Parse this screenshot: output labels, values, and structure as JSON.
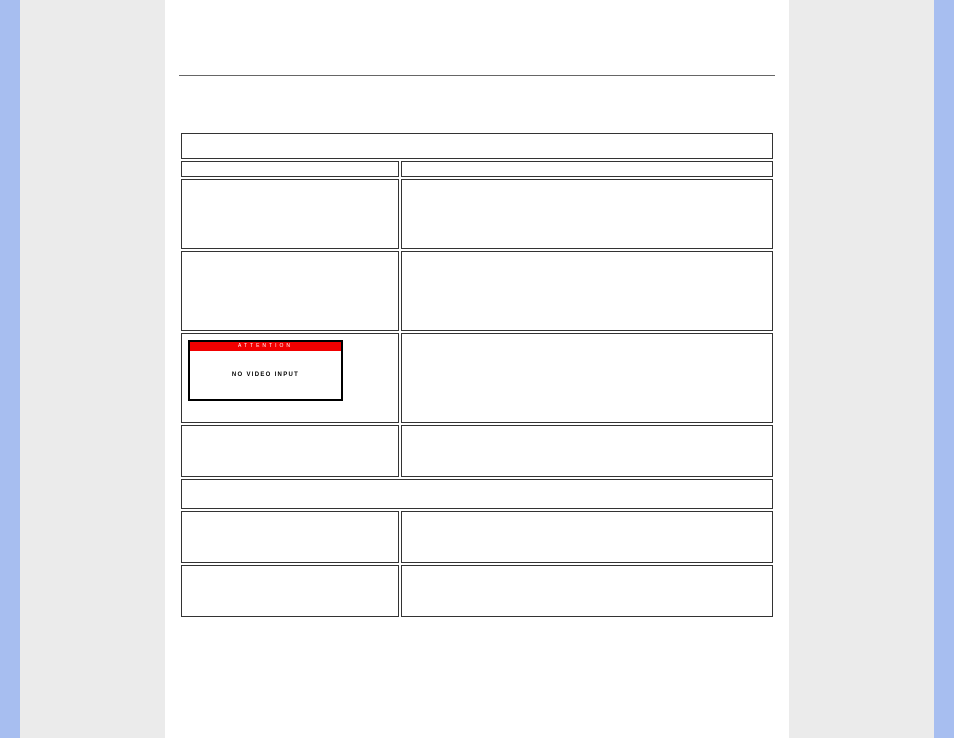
{
  "attention": {
    "header": "ATTENTION",
    "body": "NO VIDEO INPUT"
  }
}
